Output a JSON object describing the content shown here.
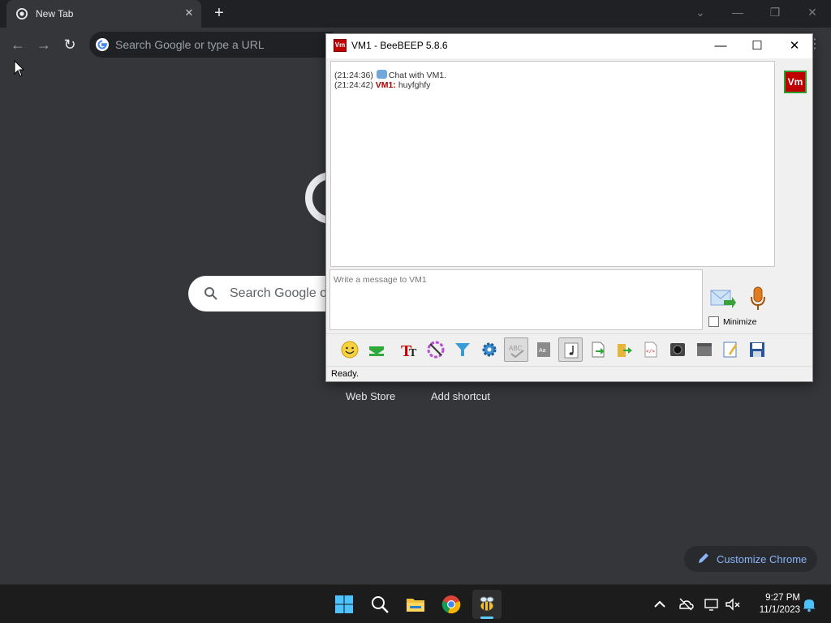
{
  "browser": {
    "tab_title": "New Tab",
    "tab_close": "✕",
    "new_tab": "+",
    "omnibox_placeholder": "Search Google or type a URL",
    "ntp_search_placeholder": "Search Google o",
    "shortcuts": [
      {
        "label": "Web Store"
      },
      {
        "label": "Add shortcut"
      }
    ],
    "customize_label": "Customize Chrome",
    "window_controls": {
      "minimize": "—",
      "restore": "❐",
      "close": "✕",
      "menu": "⋮"
    }
  },
  "beebeep": {
    "title": "VM1 - BeeBEEP 5.8.6",
    "icon_text": "Vm",
    "controls": {
      "minimize": "—",
      "maximize": "☐",
      "close": "✕"
    },
    "messages": [
      {
        "time": "(21:24:36)",
        "sender": "",
        "text": "Chat with VM1.",
        "system": true
      },
      {
        "time": "(21:24:42)",
        "sender": "VM1:",
        "text": "huyfghfy",
        "system": false
      }
    ],
    "input_placeholder": "Write a message to VM1",
    "minimize_label": "Minimize",
    "user_avatar": "Vm",
    "status": "Ready."
  },
  "taskbar": {
    "time": "9:27 PM",
    "date": "11/1/2023"
  },
  "colors": {
    "chrome_bg": "#35363a",
    "tabstrip_bg": "#202124",
    "accent_blue": "#8ab4f8",
    "beebeep_red": "#c00000",
    "taskbar_bg": "#1c1c1c"
  }
}
